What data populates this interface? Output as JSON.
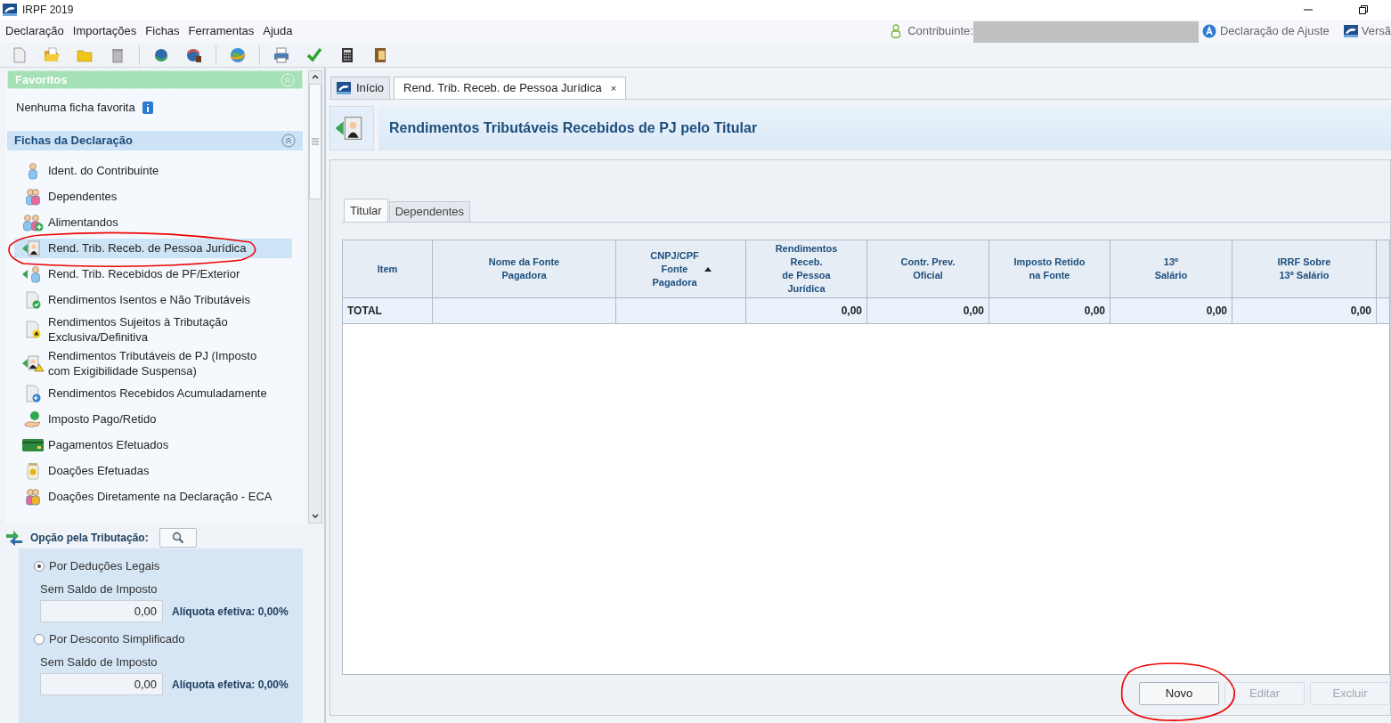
{
  "window": {
    "title": "IRPF 2019"
  },
  "menu": [
    "Declaração",
    "Importações",
    "Fichas",
    "Ferramentas",
    "Ajuda"
  ],
  "header_info": {
    "contribuinte_label": "Contribuinte:",
    "declaration_type": "Declaração de Ajuste",
    "version_label": "Versã"
  },
  "favorites": {
    "title": "Favoritos",
    "empty_text": "Nenhuma ficha favorita"
  },
  "sidebar": {
    "title": "Fichas da Declaração",
    "items": [
      {
        "label": "Ident. do Contribuinte",
        "selected": false
      },
      {
        "label": "Dependentes",
        "selected": false
      },
      {
        "label": "Alimentandos",
        "selected": false
      },
      {
        "label": "Rend. Trib. Receb. de Pessoa Jurídica",
        "selected": true
      },
      {
        "label": "Rend. Trib. Recebidos de PF/Exterior",
        "selected": false
      },
      {
        "label": "Rendimentos Isentos e Não Tributáveis",
        "selected": false
      },
      {
        "label": "Rendimentos Sujeitos à Tributação Exclusiva/Definitiva",
        "selected": false
      },
      {
        "label": "Rendimentos Tributáveis de PJ (Imposto com Exigibilidade Suspensa)",
        "selected": false
      },
      {
        "label": "Rendimentos Recebidos Acumuladamente",
        "selected": false
      },
      {
        "label": "Imposto Pago/Retido",
        "selected": false
      },
      {
        "label": "Pagamentos Efetuados",
        "selected": false
      },
      {
        "label": "Doações Efetuadas",
        "selected": false
      },
      {
        "label": "Doações Diretamente na Declaração - ECA",
        "selected": false
      }
    ]
  },
  "taxation": {
    "title": "Opção pela Tributação:",
    "options": [
      {
        "label": "Por Deduções Legais",
        "selected": true,
        "balance": {
          "label": "Sem Saldo de Imposto",
          "value": "0,00",
          "rate": "Alíquota efetiva: 0,00%"
        }
      },
      {
        "label": "Por Desconto Simplificado",
        "selected": false,
        "balance": {
          "label": "Sem Saldo de Imposto",
          "value": "0,00",
          "rate": "Alíquota efetiva: 0,00%"
        }
      }
    ]
  },
  "tabs": [
    {
      "label": "Início",
      "selected": false
    },
    {
      "label": "Rend. Trib. Receb. de Pessoa Jurídica",
      "selected": true,
      "close": "×"
    }
  ],
  "page_title": "Rendimentos Tributáveis Recebidos de PJ pelo Titular",
  "sub_tabs": [
    {
      "label": "Titular",
      "selected": true
    },
    {
      "label": "Dependentes",
      "selected": false
    }
  ],
  "table": {
    "columns": [
      {
        "label": "Item",
        "sorted": false
      },
      {
        "label": "Nome da Fonte\nPagadora",
        "sorted": false
      },
      {
        "label": "CNPJ/CPF\nFonte\nPagadora",
        "sorted": true
      },
      {
        "label": "Rendimentos\nReceb.\nde Pessoa\nJurídica",
        "sorted": false
      },
      {
        "label": "Contr. Prev.\nOficial",
        "sorted": false
      },
      {
        "label": "Imposto Retido\nna Fonte",
        "sorted": false
      },
      {
        "label": "13º\nSalário",
        "sorted": false
      },
      {
        "label": "IRRF Sobre\n13º Salário",
        "sorted": false
      }
    ],
    "total_row": {
      "label": "TOTAL",
      "values": [
        "0,00",
        "0,00",
        "0,00",
        "0,00",
        "0,00"
      ]
    }
  },
  "buttons": [
    {
      "label": "Novo",
      "disabled": false
    },
    {
      "label": "Editar",
      "disabled": true
    },
    {
      "label": "Excluir",
      "disabled": true
    }
  ]
}
